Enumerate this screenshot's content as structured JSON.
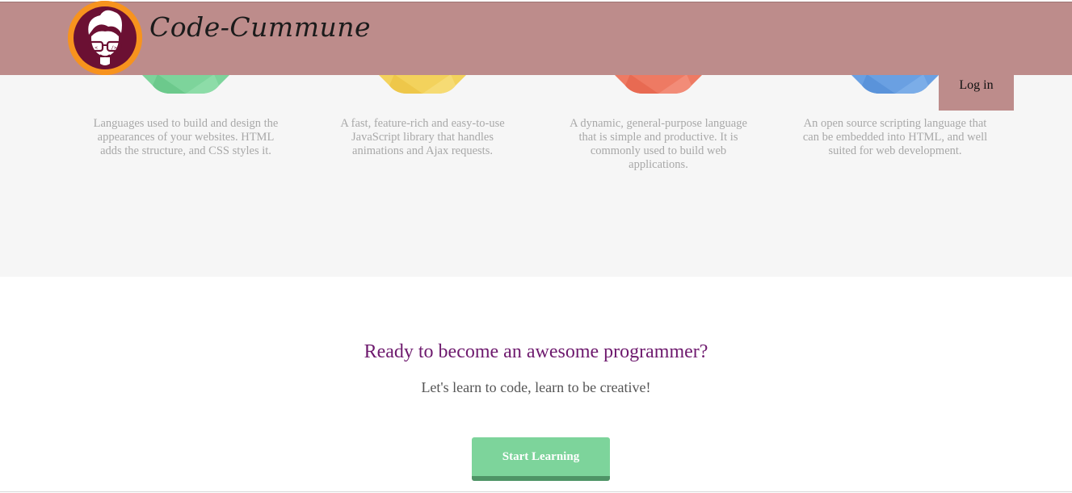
{
  "header": {
    "brand_name": "Code-Cummune",
    "background_color": "#bd8c8b",
    "logo_icon": "nerd-face-logo-icon"
  },
  "nav": {
    "login_label": "Log in"
  },
  "features": [
    {
      "icon": "green-gem-icon",
      "color": "#7dd49b",
      "description": "Languages used to build and design the appearances of your websites. HTML adds the structure, and CSS styles it."
    },
    {
      "icon": "yellow-gem-icon",
      "color": "#f3d25c",
      "description": "A fast, feature-rich and easy-to-use JavaScript library that handles animations and Ajax requests."
    },
    {
      "icon": "red-gem-icon",
      "color": "#ee7a63",
      "description": "A dynamic, general-purpose language that is simple and productive. It is commonly used to build web applications."
    },
    {
      "icon": "blue-gem-icon",
      "color": "#6aa0e2",
      "description": "An open source scripting language that can be embedded into HTML, and well suited for web development."
    }
  ],
  "cta": {
    "title": "Ready to become an awesome programmer?",
    "subtitle": "Let's learn to code, learn to be creative!",
    "button_label": "Start Learning",
    "button_color": "#7dd49b"
  }
}
